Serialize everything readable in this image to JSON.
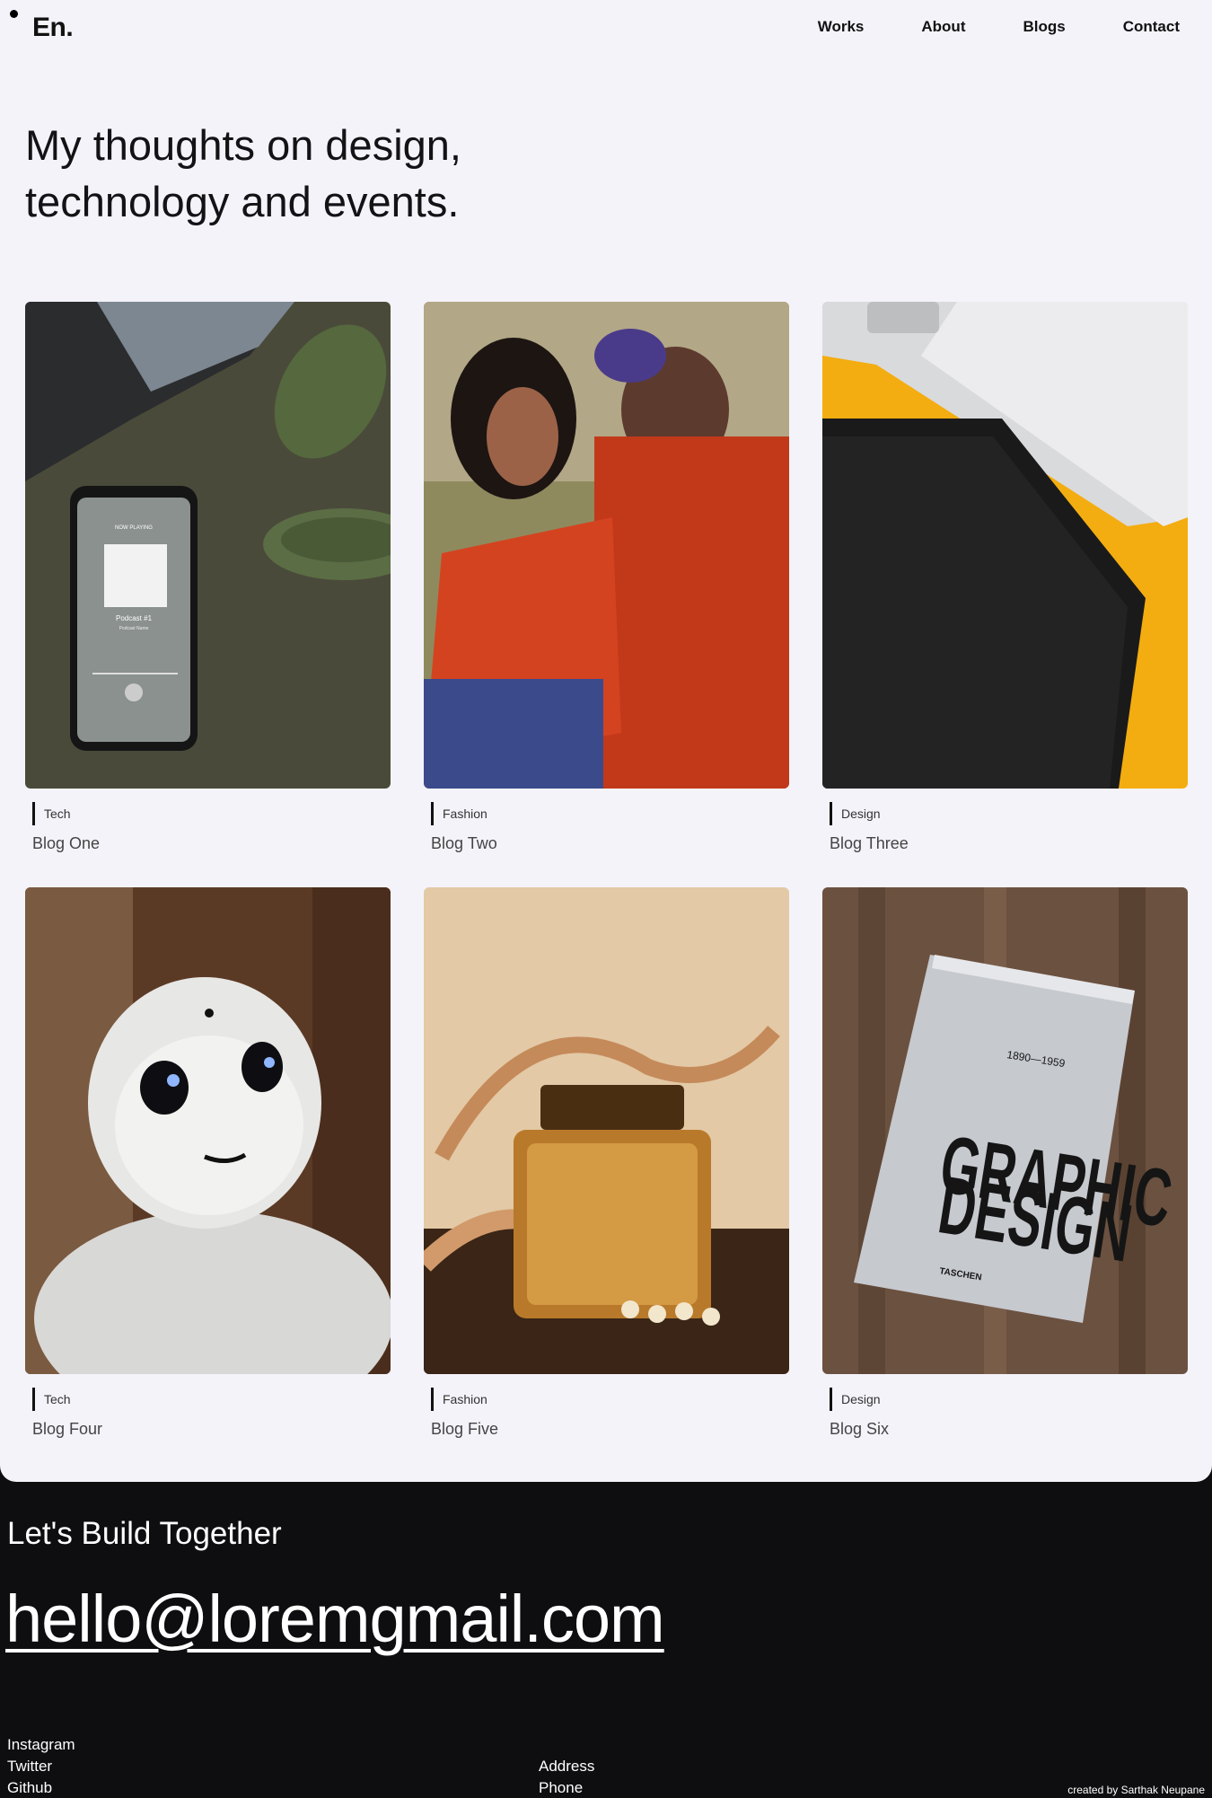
{
  "brand": {
    "logo": "En."
  },
  "nav": {
    "items": [
      "Works",
      "About",
      "Blogs",
      "Contact"
    ]
  },
  "hero": {
    "line1": "My thoughts on design,",
    "line2": "technology and events."
  },
  "blogs": [
    {
      "category": "Tech",
      "title": "Blog One",
      "image": "phone-headphones-image"
    },
    {
      "category": "Fashion",
      "title": "Blog Two",
      "image": "fashion-couple-image"
    },
    {
      "category": "Design",
      "title": "Blog Three",
      "image": "laptop-tablet-image"
    },
    {
      "category": "Tech",
      "title": "Blog Four",
      "image": "robot-image"
    },
    {
      "category": "Fashion",
      "title": "Blog Five",
      "image": "perfume-sandals-image"
    },
    {
      "category": "Design",
      "title": "Blog Six",
      "image": "graphic-design-book-image"
    }
  ],
  "phone_screen": {
    "header": "NOW PLAYING",
    "track": "Podcast #1",
    "artist": "Podcast Name"
  },
  "book_cover": {
    "line1": "GRAPHIC",
    "line2": "DESIGN",
    "years": "1890—1959",
    "publisher": "TASCHEN"
  },
  "footer": {
    "heading": "Let's Build Together",
    "email": "hello@loremgmail.com",
    "social": [
      "Instagram",
      "Twitter",
      "Github"
    ],
    "info": [
      "Address",
      "Phone"
    ],
    "credit": "created by Sarthak Neupane"
  },
  "colors": {
    "page_bg": "#f4f3fa",
    "footer_bg": "#0e0e10",
    "text": "#131316"
  }
}
